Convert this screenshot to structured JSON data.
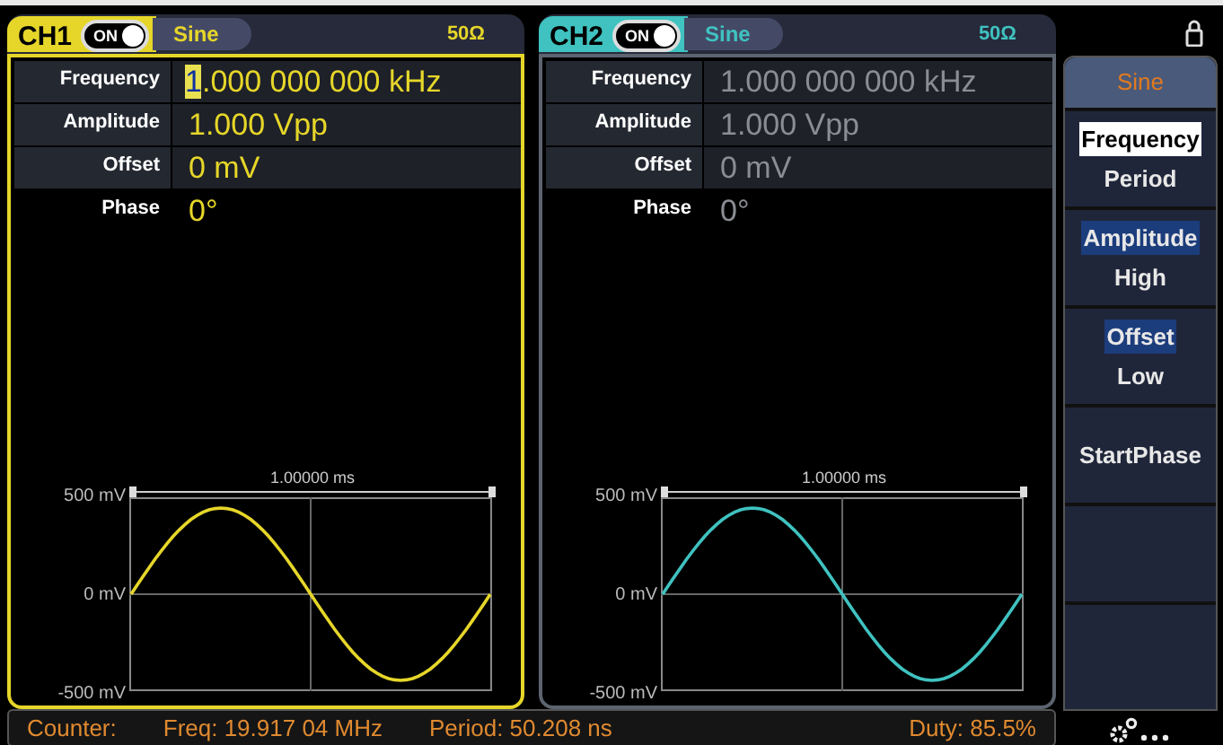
{
  "channels": [
    {
      "name": "CH1",
      "active": true,
      "on": true,
      "switch_label": "ON",
      "waveform": "Sine",
      "load": "50Ω",
      "color": "#e6d629",
      "params": [
        {
          "label": "Frequency",
          "value": "1.000 000 000 kHz",
          "cursor": true
        },
        {
          "label": "Amplitude",
          "value": "1.000 Vpp",
          "cursor": false
        },
        {
          "label": "Offset",
          "value": "0 mV",
          "cursor": false
        },
        {
          "label": "Phase",
          "value": "0°",
          "cursor": false
        }
      ],
      "preview": {
        "timescale": "1.00000 ms",
        "y_labels": [
          "500 mV",
          "0 mV",
          "-500 mV"
        ]
      }
    },
    {
      "name": "CH2",
      "active": false,
      "on": true,
      "switch_label": "ON",
      "waveform": "Sine",
      "load": "50Ω",
      "color": "#3fc2c0",
      "params": [
        {
          "label": "Frequency",
          "value": "1.000 000 000 kHz",
          "cursor": false
        },
        {
          "label": "Amplitude",
          "value": "1.000 Vpp",
          "cursor": false
        },
        {
          "label": "Offset",
          "value": "0 mV",
          "cursor": false
        },
        {
          "label": "Phase",
          "value": "0°",
          "cursor": false
        }
      ],
      "preview": {
        "timescale": "1.00000 ms",
        "y_labels": [
          "500 mV",
          "0 mV",
          "-500 mV"
        ]
      }
    }
  ],
  "menu": {
    "title": "Sine",
    "keys": [
      {
        "kind": "pair",
        "options": [
          {
            "label": "Frequency",
            "kind": "focused"
          },
          {
            "label": "Period",
            "kind": "plain"
          }
        ]
      },
      {
        "kind": "pair",
        "options": [
          {
            "label": "Amplitude",
            "kind": "chosen"
          },
          {
            "label": "High",
            "kind": "plain"
          }
        ]
      },
      {
        "kind": "pair",
        "options": [
          {
            "label": "Offset",
            "kind": "chosen"
          },
          {
            "label": "Low",
            "kind": "plain"
          }
        ]
      },
      {
        "kind": "single",
        "options": [
          {
            "label": "StartPhase",
            "kind": "plain"
          }
        ]
      },
      {
        "kind": "blank"
      },
      {
        "kind": "blank"
      }
    ]
  },
  "status_bar": {
    "title": "Counter:",
    "fields": [
      "Freq: 19.917 04 MHz",
      "Period: 50.208 ns",
      "Duty: 85.5%"
    ]
  }
}
